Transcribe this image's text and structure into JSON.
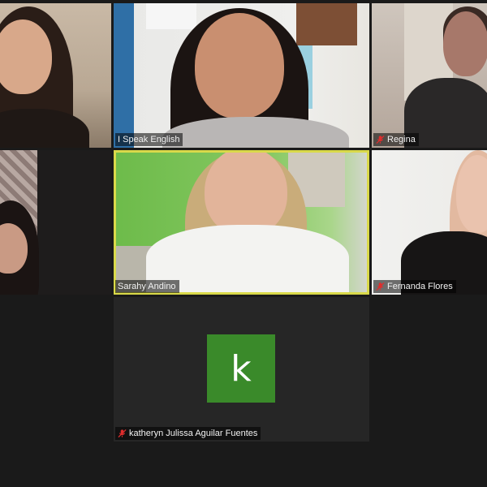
{
  "participants": [
    {
      "id": "p1",
      "name": "",
      "muted": false,
      "active": false
    },
    {
      "id": "p2",
      "name": "I Speak English",
      "muted": false,
      "active": false
    },
    {
      "id": "p3",
      "name": "Regina",
      "muted": true,
      "active": false
    },
    {
      "id": "p4",
      "name": "",
      "muted": false,
      "active": false
    },
    {
      "id": "p5",
      "name": "Sarahy Andino",
      "muted": false,
      "active": true
    },
    {
      "id": "p6",
      "name": "Fernanda Flores",
      "muted": true,
      "active": false
    },
    {
      "id": "p7",
      "name": "katheryn Julissa Aguilar Fuentes",
      "muted": true,
      "active": false,
      "avatar_letter": "k"
    }
  ],
  "colors": {
    "background": "#1a1a1a",
    "active_speaker_border": "#d9d94a",
    "avatar_green": "#3a8a2a",
    "muted_mic_red": "#e02d2d"
  },
  "icons": {
    "muted": "mic-muted-icon"
  }
}
